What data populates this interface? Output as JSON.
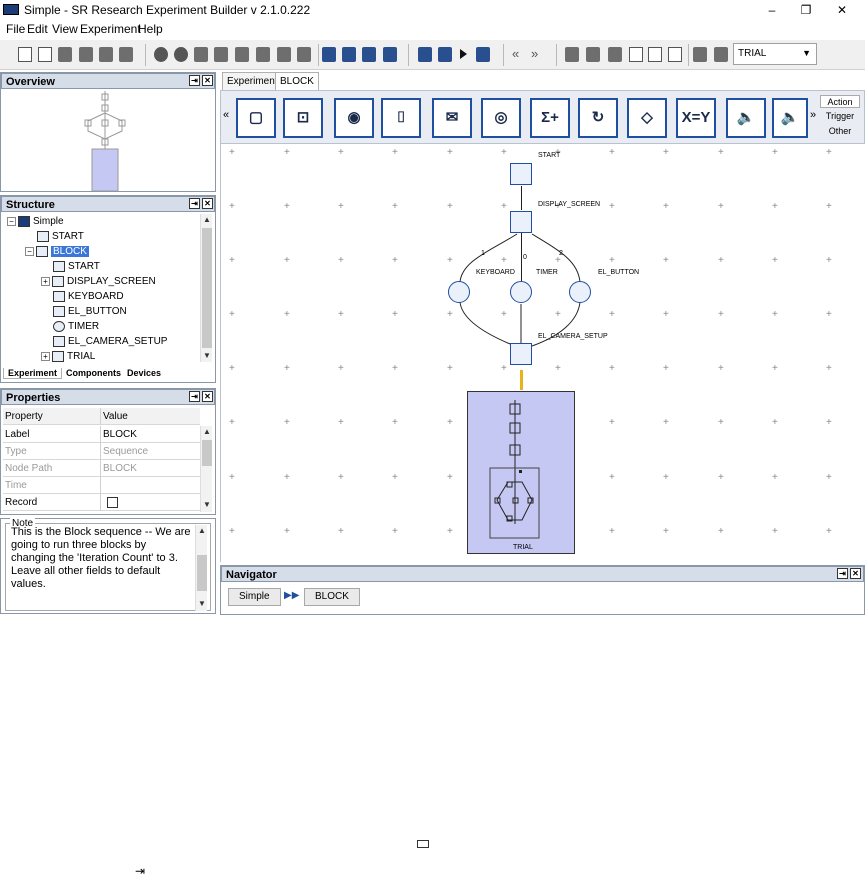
{
  "app": {
    "title": "Simple - SR Research Experiment Builder v 2.1.0.222",
    "min": "–",
    "max": "❐",
    "close": "✕"
  },
  "menu": [
    "File",
    "Edit",
    "View",
    "Experiment",
    "Help"
  ],
  "toolbar": {
    "trial_select": "TRIAL",
    "nav_back": "«",
    "nav_forward": "»"
  },
  "overview": {
    "title": "Overview"
  },
  "structure": {
    "title": "Structure",
    "items": [
      {
        "label": "Simple"
      },
      {
        "label": "START"
      },
      {
        "label": "BLOCK"
      },
      {
        "label": "START"
      },
      {
        "label": "DISPLAY_SCREEN"
      },
      {
        "label": "KEYBOARD"
      },
      {
        "label": "EL_BUTTON"
      },
      {
        "label": "TIMER"
      },
      {
        "label": "EL_CAMERA_SETUP"
      },
      {
        "label": "TRIAL"
      }
    ],
    "tabs": [
      "Experiment",
      "Components",
      "Devices"
    ]
  },
  "properties": {
    "title": "Properties",
    "headers": [
      "Property",
      "Value"
    ],
    "rows": [
      {
        "key": "Label",
        "value": "BLOCK"
      },
      {
        "key": "Type",
        "value": "Sequence"
      },
      {
        "key": "Node Path",
        "value": "BLOCK"
      },
      {
        "key": "Time",
        "value": ""
      },
      {
        "key": "Record",
        "value": ""
      }
    ]
  },
  "note": {
    "title": "Note",
    "text": "This is the Block sequence -- We are going to run three blocks by changing the 'Iteration Count' to 3. Leave all other fields to default values."
  },
  "editor": {
    "tabs": [
      "Experiment",
      "BLOCK"
    ],
    "palette_side": [
      "Action",
      "Trigger",
      "Other"
    ],
    "palette_glyphs": [
      "X=Y",
      "Σ+"
    ]
  },
  "canvas": {
    "nodes": {
      "start": "START",
      "display": "DISPLAY_SCREEN",
      "keyboard": "KEYBOARD",
      "timer": "TIMER",
      "el_button": "EL_BUTTON",
      "camera": "EL_CAMERA_SETUP",
      "trial": "TRIAL"
    },
    "edge_labels": [
      "1",
      "0",
      "2"
    ]
  },
  "navigator": {
    "title": "Navigator",
    "crumbs": [
      "Simple",
      "BLOCK"
    ],
    "sep": "▶▶"
  }
}
